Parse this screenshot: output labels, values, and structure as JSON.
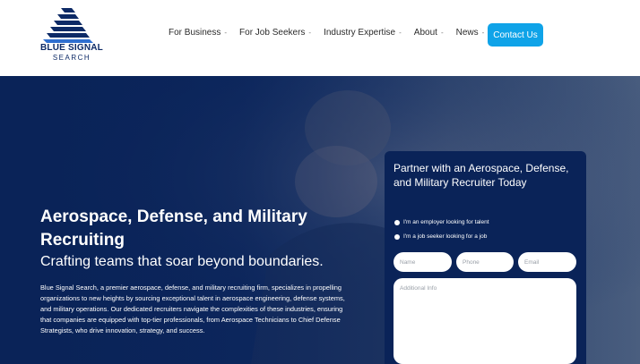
{
  "brand": {
    "line1": "BLUE SIGNAL",
    "line2": "SEARCH",
    "color": "#0d2a66"
  },
  "nav": {
    "items": [
      {
        "label": "For Business",
        "caret": "-"
      },
      {
        "label": "For Job Seekers",
        "caret": "-"
      },
      {
        "label": "Industry Expertise",
        "caret": "-"
      },
      {
        "label": "About",
        "caret": "-"
      },
      {
        "label": "News",
        "caret": "-"
      }
    ],
    "contact_label": "Contact Us",
    "contact_color": "#0fa3e8"
  },
  "hero": {
    "title": "Aerospace, Defense, and Military Recruiting",
    "subtitle": "Crafting teams that soar beyond boundaries.",
    "body": "Blue Signal Search, a premier aerospace, defense, and military recruiting firm, specializes in propelling organizations to new heights by sourcing exceptional talent in aerospace engineering, defense systems, and military operations. Our dedicated recruiters navigate the complexities of these industries, ensuring that companies are equipped with top-tier professionals, from Aerospace Technicians to Chief Defense Strategists, who drive innovation, strategy, and success.",
    "background_color": "#0a2358"
  },
  "form": {
    "title": "Partner with an Aerospace, Defense, and Military Recruiter Today",
    "options": [
      "I'm an employer looking for talent",
      "I'm a job seeker looking for a job"
    ],
    "fields": {
      "name_placeholder": "Name",
      "phone_placeholder": "Phone",
      "email_placeholder": "Email",
      "info_placeholder": "Additional Info"
    }
  }
}
